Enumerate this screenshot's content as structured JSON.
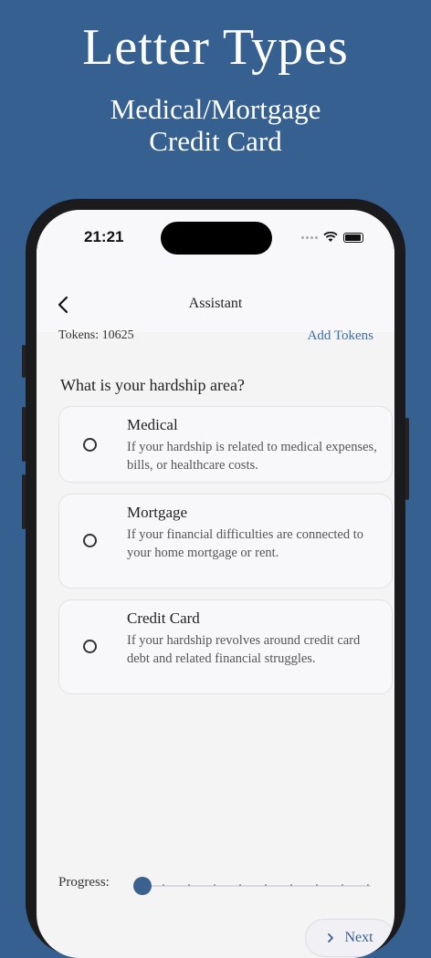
{
  "promo": {
    "title": "Letter Types",
    "subtitle_line1": "Medical/Mortgage",
    "subtitle_line2": "Credit Card"
  },
  "status_bar": {
    "time": "21:21"
  },
  "nav": {
    "title": "Assistant"
  },
  "tokens": {
    "label": "Tokens: 10625",
    "add_label": "Add Tokens"
  },
  "question": "What is your hardship area?",
  "options": [
    {
      "title": "Medical",
      "description": "If your hardship is related to medical expenses, bills, or healthcare costs."
    },
    {
      "title": "Mortgage",
      "description": "If your financial difficulties are connected to your home mortgage or rent."
    },
    {
      "title": "Credit Card",
      "description": "If your hardship revolves around credit card debt and related financial struggles."
    }
  ],
  "progress": {
    "label": "Progress:",
    "value": 0
  },
  "next_button": {
    "label": "Next"
  },
  "colors": {
    "background": "#35608f",
    "accent": "#3f6ea5",
    "slider_thumb": "#3a6190"
  }
}
